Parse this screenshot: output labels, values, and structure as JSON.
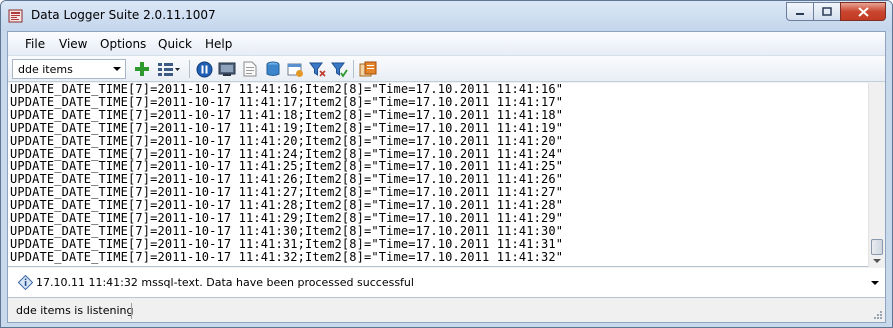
{
  "window": {
    "title": "Data Logger Suite 2.0.11.1007"
  },
  "menu": {
    "items": [
      {
        "label": "File"
      },
      {
        "label": "View"
      },
      {
        "label": "Options"
      },
      {
        "label": "Quick"
      },
      {
        "label": "Help"
      }
    ]
  },
  "toolbar": {
    "combo_value": "dde items",
    "icons": [
      "add-icon",
      "list-options-icon",
      "pause-icon",
      "monitor-icon",
      "document-icon",
      "database-icon",
      "calendar-icon",
      "filter-icon",
      "filter-apply-icon",
      "export-icon"
    ]
  },
  "log": {
    "lines": [
      "UPDATE_DATE_TIME[7]=2011-10-17 11:41:16;Item2[8]=\"Time=17.10.2011 11:41:16\"",
      "UPDATE_DATE_TIME[7]=2011-10-17 11:41:17;Item2[8]=\"Time=17.10.2011 11:41:17\"",
      "UPDATE_DATE_TIME[7]=2011-10-17 11:41:18;Item2[8]=\"Time=17.10.2011 11:41:18\"",
      "UPDATE_DATE_TIME[7]=2011-10-17 11:41:19;Item2[8]=\"Time=17.10.2011 11:41:19\"",
      "UPDATE_DATE_TIME[7]=2011-10-17 11:41:20;Item2[8]=\"Time=17.10.2011 11:41:20\"",
      "UPDATE_DATE_TIME[7]=2011-10-17 11:41:24;Item2[8]=\"Time=17.10.2011 11:41:24\"",
      "UPDATE_DATE_TIME[7]=2011-10-17 11:41:25;Item2[8]=\"Time=17.10.2011 11:41:25\"",
      "UPDATE_DATE_TIME[7]=2011-10-17 11:41:26;Item2[8]=\"Time=17.10.2011 11:41:26\"",
      "UPDATE_DATE_TIME[7]=2011-10-17 11:41:27;Item2[8]=\"Time=17.10.2011 11:41:27\"",
      "UPDATE_DATE_TIME[7]=2011-10-17 11:41:28;Item2[8]=\"Time=17.10.2011 11:41:28\"",
      "UPDATE_DATE_TIME[7]=2011-10-17 11:41:29;Item2[8]=\"Time=17.10.2011 11:41:29\"",
      "UPDATE_DATE_TIME[7]=2011-10-17 11:41:30;Item2[8]=\"Time=17.10.2011 11:41:30\"",
      "UPDATE_DATE_TIME[7]=2011-10-17 11:41:31;Item2[8]=\"Time=17.10.2011 11:41:31\"",
      "UPDATE_DATE_TIME[7]=2011-10-17 11:41:32;Item2[8]=\"Time=17.10.2011 11:41:32\""
    ]
  },
  "message": {
    "text": "17.10.11 11:41:32 mssql-text. Data have been processed successful",
    "icon": "info-diamond-icon"
  },
  "status": {
    "text": "dde items is listening"
  },
  "colors": {
    "titlebar": "#c4d6ec",
    "close_button": "#c94630",
    "accent_green": "#2e9a2e",
    "accent_blue": "#1f5fb4"
  }
}
